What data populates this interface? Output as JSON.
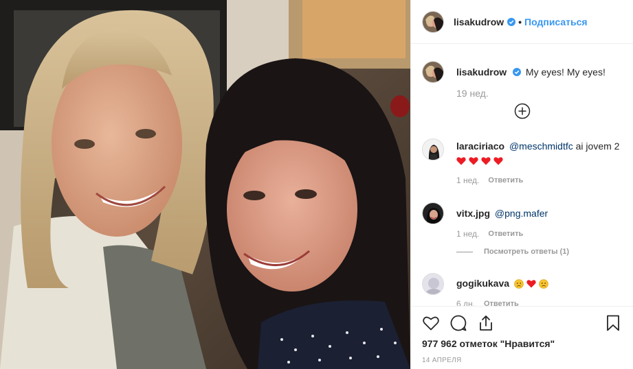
{
  "header": {
    "username": "lisakudrow",
    "separator": "•",
    "follow_label": "Подписаться"
  },
  "caption": {
    "username": "lisakudrow",
    "text": "My eyes! My eyes!",
    "time": "19 нед."
  },
  "comments": [
    {
      "username": "laraciriaco",
      "mention": "@meschmidtfc",
      "text": "ai jovem 2",
      "emoji": [
        "heart",
        "heart",
        "heart",
        "heart"
      ],
      "time": "1 нед.",
      "reply_label": "Ответить"
    },
    {
      "username": "vitx.jpg",
      "mention": "@png.mafer",
      "text": "",
      "time": "1 нед.",
      "reply_label": "Ответить",
      "view_replies": "Посмотреть ответы (1)"
    },
    {
      "username": "gogikukava",
      "emoji": [
        "sad-face",
        "heart",
        "sad-face"
      ],
      "time": "6 дн.",
      "reply_label": "Ответить"
    }
  ],
  "footer": {
    "likes": "977 962 отметок \"Нравится\"",
    "date": "14 АПРЕЛЯ"
  },
  "colors": {
    "link": "#3897f0",
    "mention": "#003569",
    "muted": "#999999",
    "heart": "#ed1c24"
  }
}
